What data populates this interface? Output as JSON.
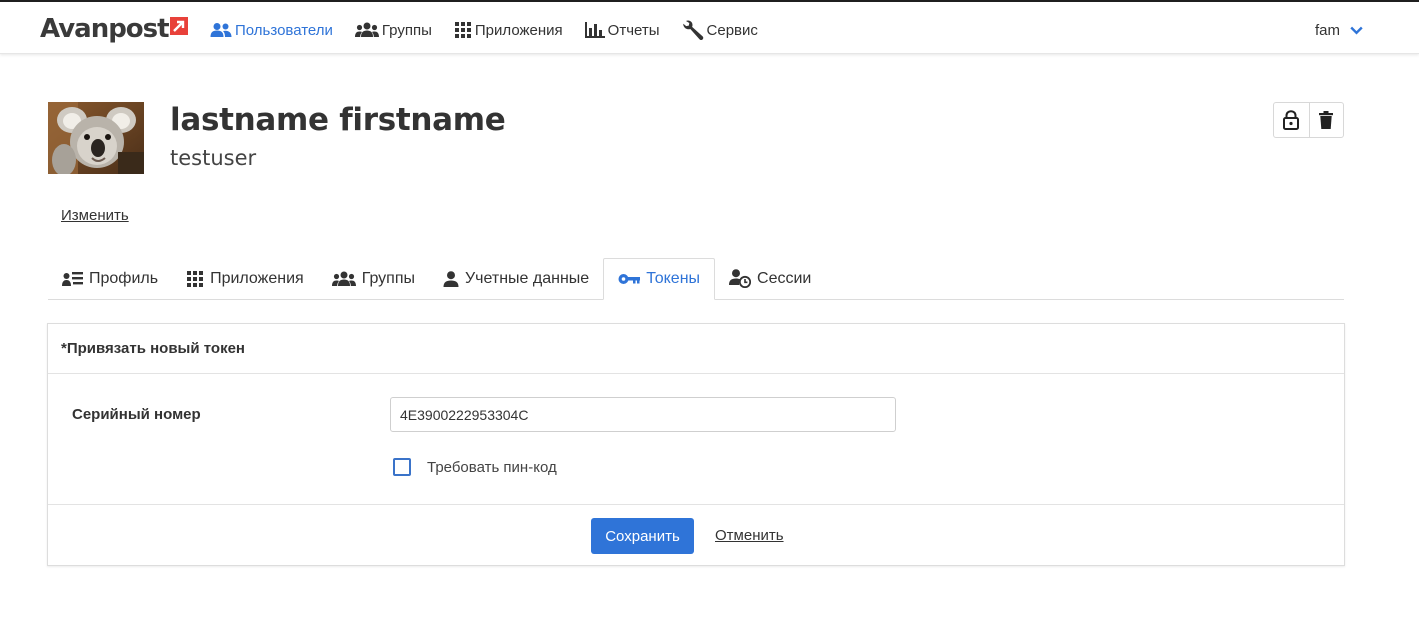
{
  "brand": {
    "logo_text": "Avanpost",
    "accent_color": "#e8413a"
  },
  "nav": {
    "items": [
      {
        "label": "Пользователи",
        "icon": "users-icon",
        "active": true
      },
      {
        "label": "Группы",
        "icon": "groups-icon",
        "active": false
      },
      {
        "label": "Приложения",
        "icon": "apps-grid-icon",
        "active": false
      },
      {
        "label": "Отчеты",
        "icon": "reports-chart-icon",
        "active": false
      },
      {
        "label": "Сервис",
        "icon": "wrench-icon",
        "active": false
      }
    ],
    "user": {
      "name": "fam",
      "icon": "chevron-down-icon"
    }
  },
  "profile": {
    "full_name": "lastname firstname",
    "username": "testuser",
    "avatar_alt": "koala-photo",
    "edit_label": "Изменить",
    "actions": [
      "lock-icon",
      "trash-icon"
    ]
  },
  "tabs": [
    {
      "label": "Профиль",
      "icon": "profile-list-icon",
      "active": false
    },
    {
      "label": "Приложения",
      "icon": "apps-grid-icon",
      "active": false
    },
    {
      "label": "Группы",
      "icon": "groups-icon",
      "active": false
    },
    {
      "label": "Учетные данные",
      "icon": "user-icon",
      "active": false
    },
    {
      "label": "Токены",
      "icon": "key-icon",
      "active": true
    },
    {
      "label": "Сессии",
      "icon": "user-clock-icon",
      "active": false
    }
  ],
  "token_form": {
    "title": "*Привязать новый токен",
    "serial_label": "Серийный номер",
    "serial_value": "4E3900222953304C",
    "require_pin_label": "Требовать пин-код",
    "require_pin_checked": false,
    "save_label": "Сохранить",
    "cancel_label": "Отменить"
  },
  "colors": {
    "primary": "#2f74d8",
    "text": "#333333",
    "border": "#dddddd"
  }
}
